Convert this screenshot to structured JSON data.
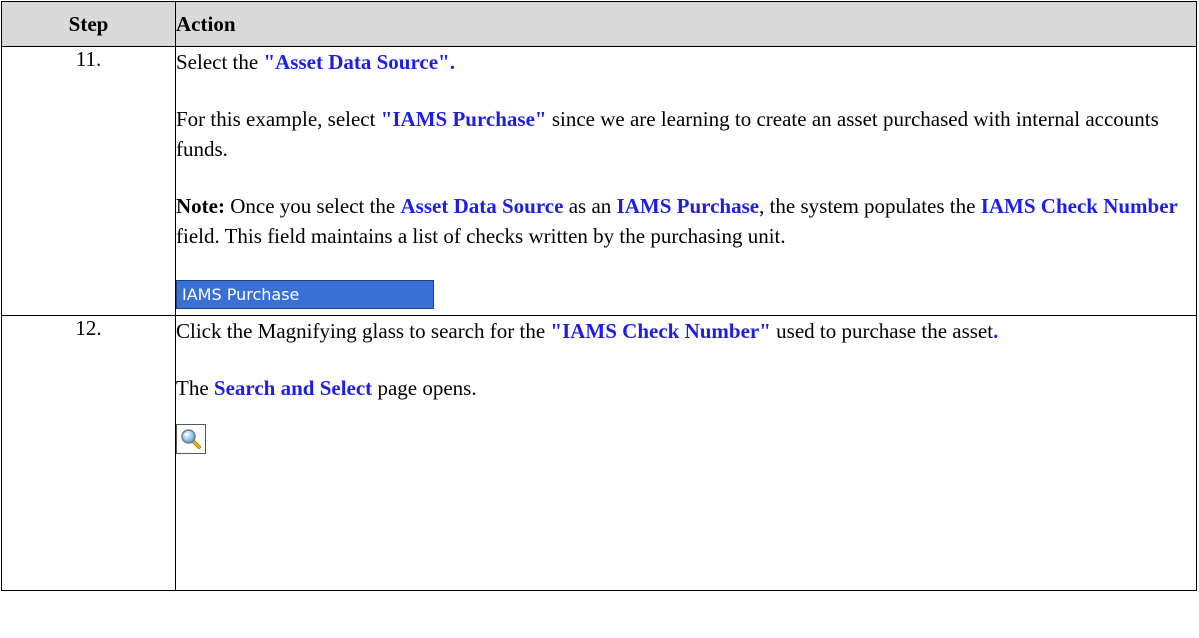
{
  "table": {
    "headers": {
      "step": "Step",
      "action": "Action"
    },
    "rows": [
      {
        "step": "11.",
        "p1": {
          "t1": "Select the ",
          "h1": "\"Asset Data Source\"."
        },
        "p2": {
          "t1": "For this example, select ",
          "h1": "\"IAMS Purchase\"",
          "t2": " since we are learning to create an asset purchased with internal accounts funds."
        },
        "p3": {
          "note": "Note:",
          "t1": " Once you select the ",
          "h1": "Asset Data Source",
          "t2": " as an ",
          "h2": "IAMS Purchase",
          "t3": ", the system populates the ",
          "h3": "IAMS Check Number",
          "t4": " field.  This field maintains a list of checks written by the purchasing unit."
        },
        "field_value": "IAMS Purchase"
      },
      {
        "step": "12.",
        "p1": {
          "t1": "Click the Magnifying glass to search for the ",
          "h1": "\"IAMS Check Number\"",
          "t2": " used to purchase the asset",
          "h2": "."
        },
        "p2": {
          "t1": "The ",
          "h1": "Search and Select",
          "t2": " page opens."
        },
        "icon": "magnifying-glass-icon"
      }
    ]
  },
  "colors": {
    "highlight": "#1f1fe0",
    "header_bg": "#d9d9d9",
    "field_bg": "#3a6fd4"
  }
}
